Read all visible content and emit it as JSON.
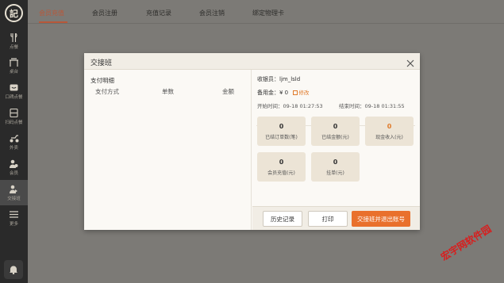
{
  "logo": {
    "text": "記"
  },
  "sidebar": {
    "items": [
      {
        "label": "点餐",
        "icon": "fork-knife-icon"
      },
      {
        "label": "桌台",
        "icon": "table-icon"
      },
      {
        "label": "口碑点餐",
        "icon": "koubei-icon"
      },
      {
        "label": "扫码点餐",
        "icon": "scan-order-icon"
      },
      {
        "label": "外卖",
        "icon": "delivery-icon"
      },
      {
        "label": "会员",
        "icon": "member-icon"
      },
      {
        "label": "交接班",
        "icon": "shift-handover-icon"
      },
      {
        "label": "更多",
        "icon": "more-list-icon"
      }
    ],
    "active_index": 6,
    "bell_icon": "bell-icon"
  },
  "tabs": [
    {
      "label": "会员充值"
    },
    {
      "label": "会员注册"
    },
    {
      "label": "充值记录"
    },
    {
      "label": "会员注销"
    },
    {
      "label": "绑定物理卡"
    }
  ],
  "dialog": {
    "title": "交接班",
    "left": {
      "title": "支付明细",
      "columns": [
        "支付方式",
        "单数",
        "金额"
      ]
    },
    "right": {
      "cashier_label": "收银员：",
      "cashier_value": "ljm_lsld",
      "reserve_label": "备用金：",
      "reserve_value": "¥ 0",
      "edit_label": "修改",
      "start_label": "开始时间：",
      "start_value": "09-18 01:27:53",
      "end_label": "结束时间：",
      "end_value": "09-18 01:31:55",
      "stats": [
        {
          "value": "0",
          "label": "已结订单数(笔)"
        },
        {
          "value": "0",
          "label": "已结金额(元)"
        },
        {
          "value": "0",
          "label": "现金收入(元)"
        },
        {
          "value": "0",
          "label": "会员充值(元)"
        },
        {
          "value": "0",
          "label": "挂单(元)"
        }
      ]
    },
    "buttons": {
      "history": "历史记录",
      "print": "打印",
      "handover_logout": "交接班并退出账号"
    }
  },
  "colors": {
    "accent": "#e9702c",
    "active_tab": "#b8583a",
    "sidebar_bg": "#2a2a2a"
  },
  "watermark": "宏宇网软件园"
}
